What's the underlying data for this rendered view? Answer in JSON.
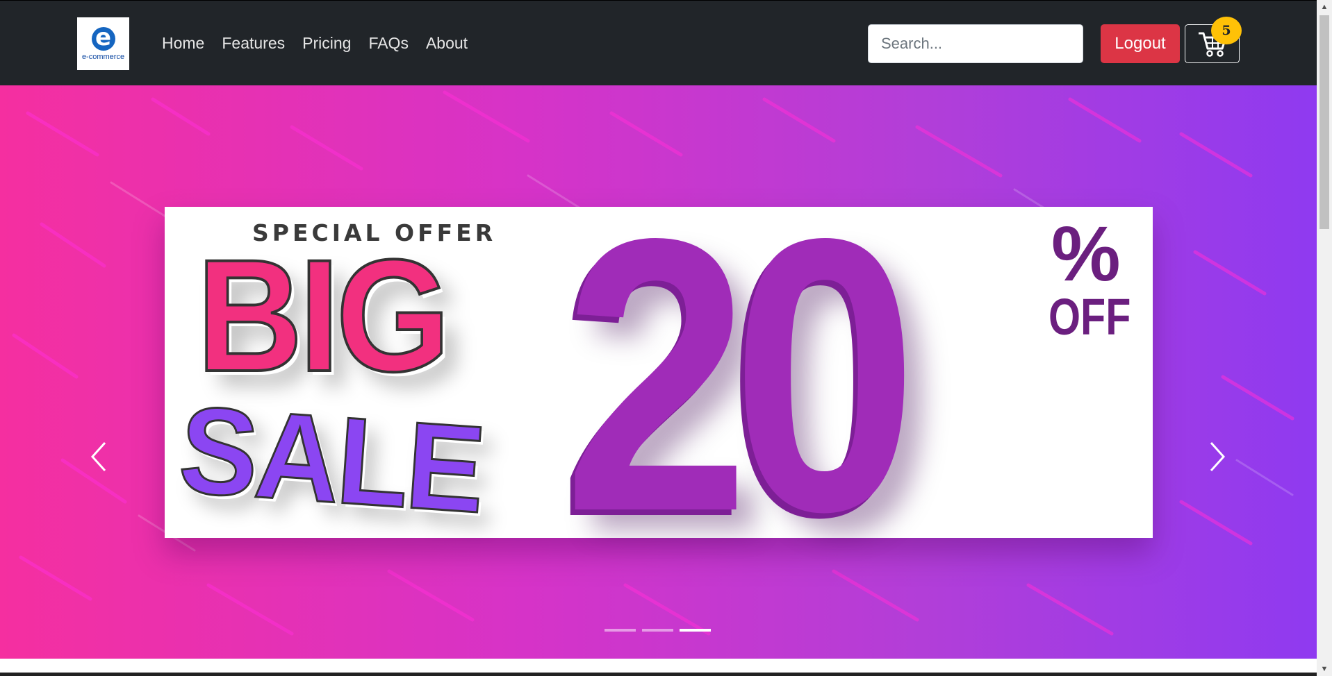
{
  "navbar": {
    "logo_text": "e-commerce",
    "links": [
      "Home",
      "Features",
      "Pricing",
      "FAQs",
      "About"
    ],
    "search_placeholder": "Search...",
    "logout_label": "Logout",
    "cart_count": "5"
  },
  "carousel": {
    "slide": {
      "top_text": "SPECIAL OFFER",
      "word1": "BIG",
      "word2": "SALE",
      "amount": "20",
      "percent": "%",
      "off": "OFF"
    },
    "indicator_count": 3,
    "active_indicator": 3
  },
  "colors": {
    "navbar_bg": "#212529",
    "logout_bg": "#dc3545",
    "badge_bg": "#ffc107",
    "big_text": "#f2307f",
    "sale_text": "#8b46f2",
    "twenty_text": "#a02cb8"
  },
  "icons": {
    "cart": "cart-icon",
    "prev": "chevron-left-icon",
    "next": "chevron-right-icon"
  }
}
